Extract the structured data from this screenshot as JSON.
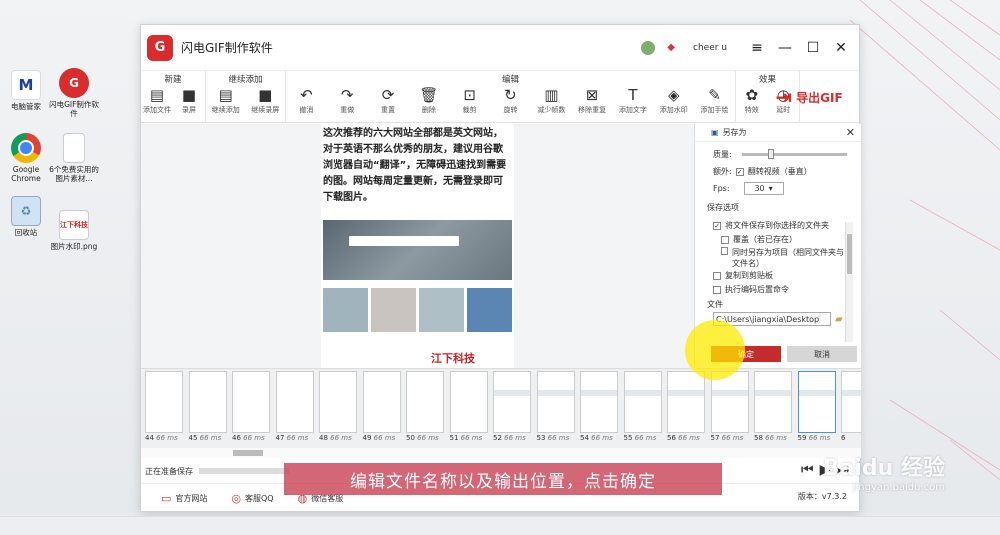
{
  "desktop": {
    "icons": [
      {
        "label": "电脑管家",
        "glyph": "M"
      },
      {
        "label": "闪电GIF制作软件",
        "glyph": "G"
      },
      {
        "label": "Google Chrome",
        "glyph": ""
      },
      {
        "label": "6个免费实用的图片素材...",
        "glyph": ""
      },
      {
        "label": "回收站",
        "glyph": "♻"
      },
      {
        "label": "图片水印.png",
        "glyph": "江下科技"
      }
    ]
  },
  "app": {
    "logo": "G",
    "title": "闪电GIF制作软件",
    "user": "cheer u",
    "groups": [
      {
        "title": "新建",
        "tools": [
          {
            "icon": "file-icon",
            "glyph": "▤",
            "label": "添加文件"
          },
          {
            "icon": "record-icon",
            "glyph": "■",
            "label": "录屏"
          }
        ]
      },
      {
        "title": "继续添加",
        "tools": [
          {
            "icon": "file-icon",
            "glyph": "▤",
            "label": "继续添加"
          },
          {
            "icon": "record-icon",
            "glyph": "■",
            "label": "继续录屏"
          }
        ]
      },
      {
        "title": "编辑",
        "tools": [
          {
            "icon": "undo-icon",
            "glyph": "↶",
            "label": "撤消"
          },
          {
            "icon": "redo-icon",
            "glyph": "↷",
            "label": "重做"
          },
          {
            "icon": "reset-icon",
            "glyph": "⟳",
            "label": "重置"
          },
          {
            "icon": "delete-icon",
            "glyph": "🗑",
            "label": "删除"
          },
          {
            "icon": "crop-icon",
            "glyph": "⊡",
            "label": "裁剪"
          },
          {
            "icon": "rotate-icon",
            "glyph": "↻",
            "label": "旋转"
          },
          {
            "icon": "reduce-frames-icon",
            "glyph": "▥",
            "label": "减少帧数"
          },
          {
            "icon": "remove-duplicate-icon",
            "glyph": "⊠",
            "label": "移除重复"
          },
          {
            "icon": "text-icon",
            "glyph": "T",
            "label": "添加文字"
          },
          {
            "icon": "watermark-icon",
            "glyph": "◈",
            "label": "添加水印"
          },
          {
            "icon": "pen-icon",
            "glyph": "✎",
            "label": "添加手绘"
          }
        ]
      },
      {
        "title": "效果",
        "tools": [
          {
            "icon": "effects-icon",
            "glyph": "✿",
            "label": "特效"
          },
          {
            "icon": "delay-icon",
            "glyph": "◷",
            "label": "延时"
          }
        ]
      }
    ],
    "export_label": "导出GIF",
    "preview": {
      "text": "这次推荐的六大网站全部都是英文网站，对于英语不那么优秀的朋友，建议用谷歌浏览器自动“翻译”，无障碍迅速找到需要的图。网站每周定量更新，无需登录即可下载图片。",
      "brand": "江下科技"
    },
    "saveas": {
      "title": "另存为",
      "quality_label": "质量:",
      "quality": 0.25,
      "extra_label": "额外:",
      "flip_label": "翻转视频（垂直）",
      "fps_label": "Fps:",
      "fps_value": "30",
      "save_options_title": "保存选项",
      "options": [
        {
          "label": "将文件保存到你选择的文件夹",
          "checked": true
        },
        {
          "label": "覆盖（若已存在）",
          "checked": false
        },
        {
          "label": "同时另存为项目（相同文件夹与文件名）",
          "checked": false
        },
        {
          "label": "复制到剪贴板",
          "checked": false
        },
        {
          "label": "执行编码后置命令",
          "checked": false
        }
      ],
      "file_label": "文件",
      "path": "C:\\Users\\jiangxia\\Desktop",
      "ok": "确定",
      "cancel": "取消"
    },
    "frames": [
      {
        "n": "44",
        "ms": "66 ms"
      },
      {
        "n": "45",
        "ms": "66 ms"
      },
      {
        "n": "46",
        "ms": "66 ms"
      },
      {
        "n": "47",
        "ms": "66 ms"
      },
      {
        "n": "48",
        "ms": "66 ms"
      },
      {
        "n": "49",
        "ms": "66 ms"
      },
      {
        "n": "50",
        "ms": "66 ms"
      },
      {
        "n": "51",
        "ms": "66 ms"
      },
      {
        "n": "52",
        "ms": "66 ms"
      },
      {
        "n": "53",
        "ms": "66 ms"
      },
      {
        "n": "54",
        "ms": "66 ms"
      },
      {
        "n": "55",
        "ms": "66 ms"
      },
      {
        "n": "56",
        "ms": "66 ms"
      },
      {
        "n": "57",
        "ms": "66 ms"
      },
      {
        "n": "58",
        "ms": "66 ms"
      },
      {
        "n": "59",
        "ms": "66 ms"
      },
      {
        "n": "6",
        "ms": ""
      }
    ],
    "status_text": "正在准备保存",
    "progress": 0.0,
    "footer": [
      {
        "icon": "monitor-icon",
        "glyph": "▭",
        "label": "官方网站"
      },
      {
        "icon": "qq-icon",
        "glyph": "◎",
        "label": "客服QQ"
      },
      {
        "icon": "wechat-icon",
        "glyph": "◍",
        "label": "微信客服"
      }
    ],
    "version": "版本：v7.3.2"
  },
  "caption": "编辑文件名称以及输出位置，点击确定",
  "watermark": {
    "brand": "Baidu 经验",
    "url": "jingyan.baidu.com"
  }
}
